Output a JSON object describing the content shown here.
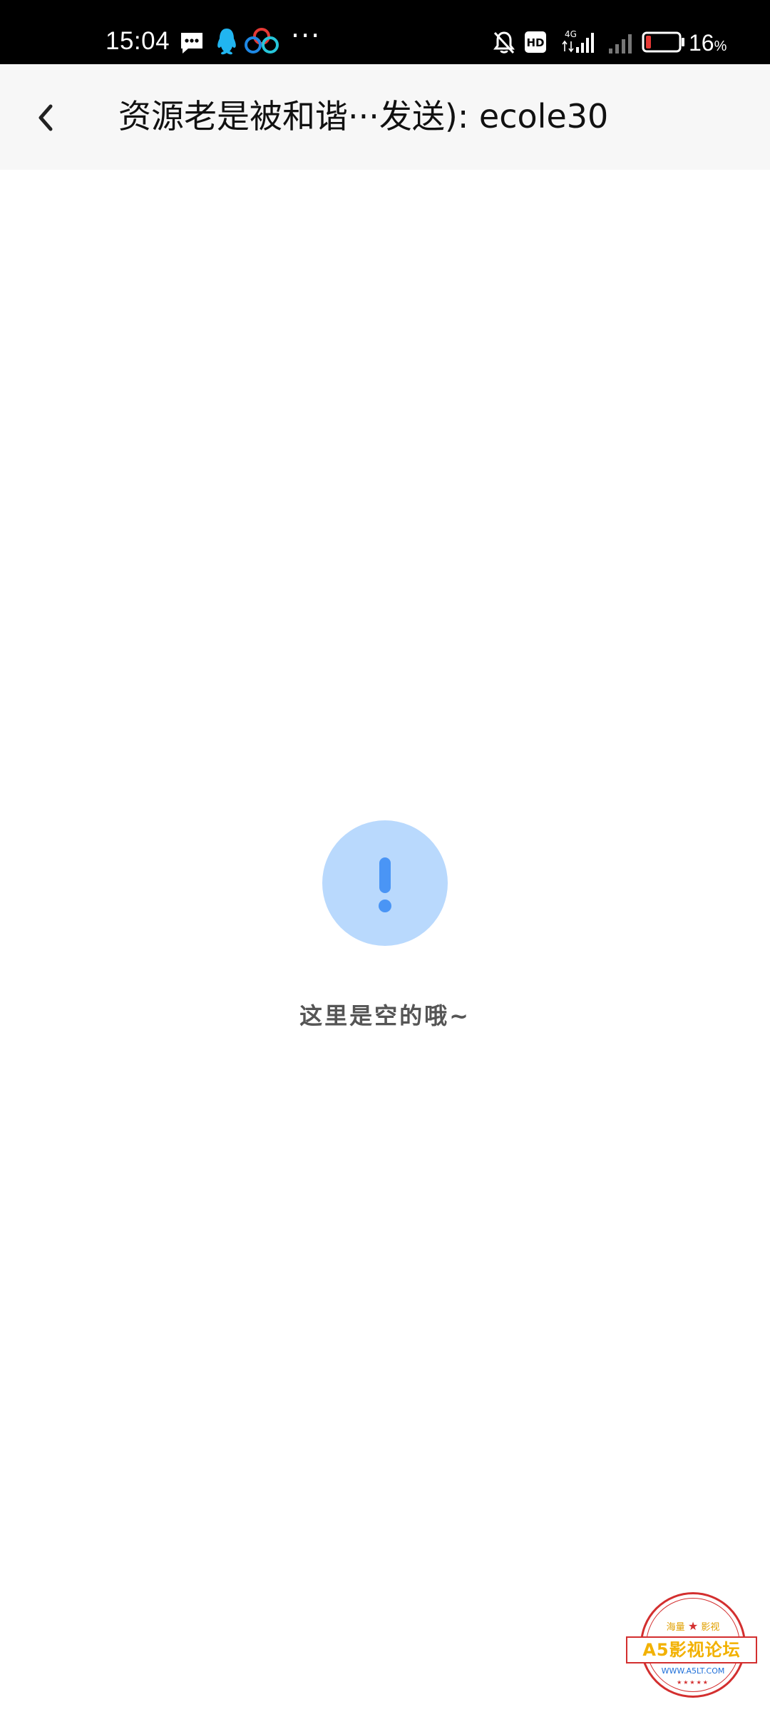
{
  "status_bar": {
    "time": "15:04",
    "more_indicator": "···",
    "battery_percent": "16",
    "battery_unit": "%",
    "network_label": "4G",
    "hd_label": "HD",
    "icons": [
      "message-icon",
      "qq-icon",
      "baidu-netdisk-icon",
      "notifications-muted-icon",
      "hd-icon",
      "signal-4g-icon",
      "signal-icon",
      "battery-icon"
    ],
    "battery_level": 0.16,
    "battery_color": "#e53935"
  },
  "nav": {
    "back_icon": "chevron-left-icon",
    "title": "资源老是被和谐···发送): ecole30"
  },
  "empty_state": {
    "icon": "exclamation-icon",
    "icon_color": "#4a95f5",
    "circle_color": "#b9d9fd",
    "message": "这里是空的哦~"
  },
  "watermark": {
    "top_text_left": "海量",
    "top_text_right": "影视",
    "star": "★",
    "banner": "A5影视论坛",
    "url": "WWW.A5LT.COM",
    "bottom_stars": "★★★★★"
  }
}
